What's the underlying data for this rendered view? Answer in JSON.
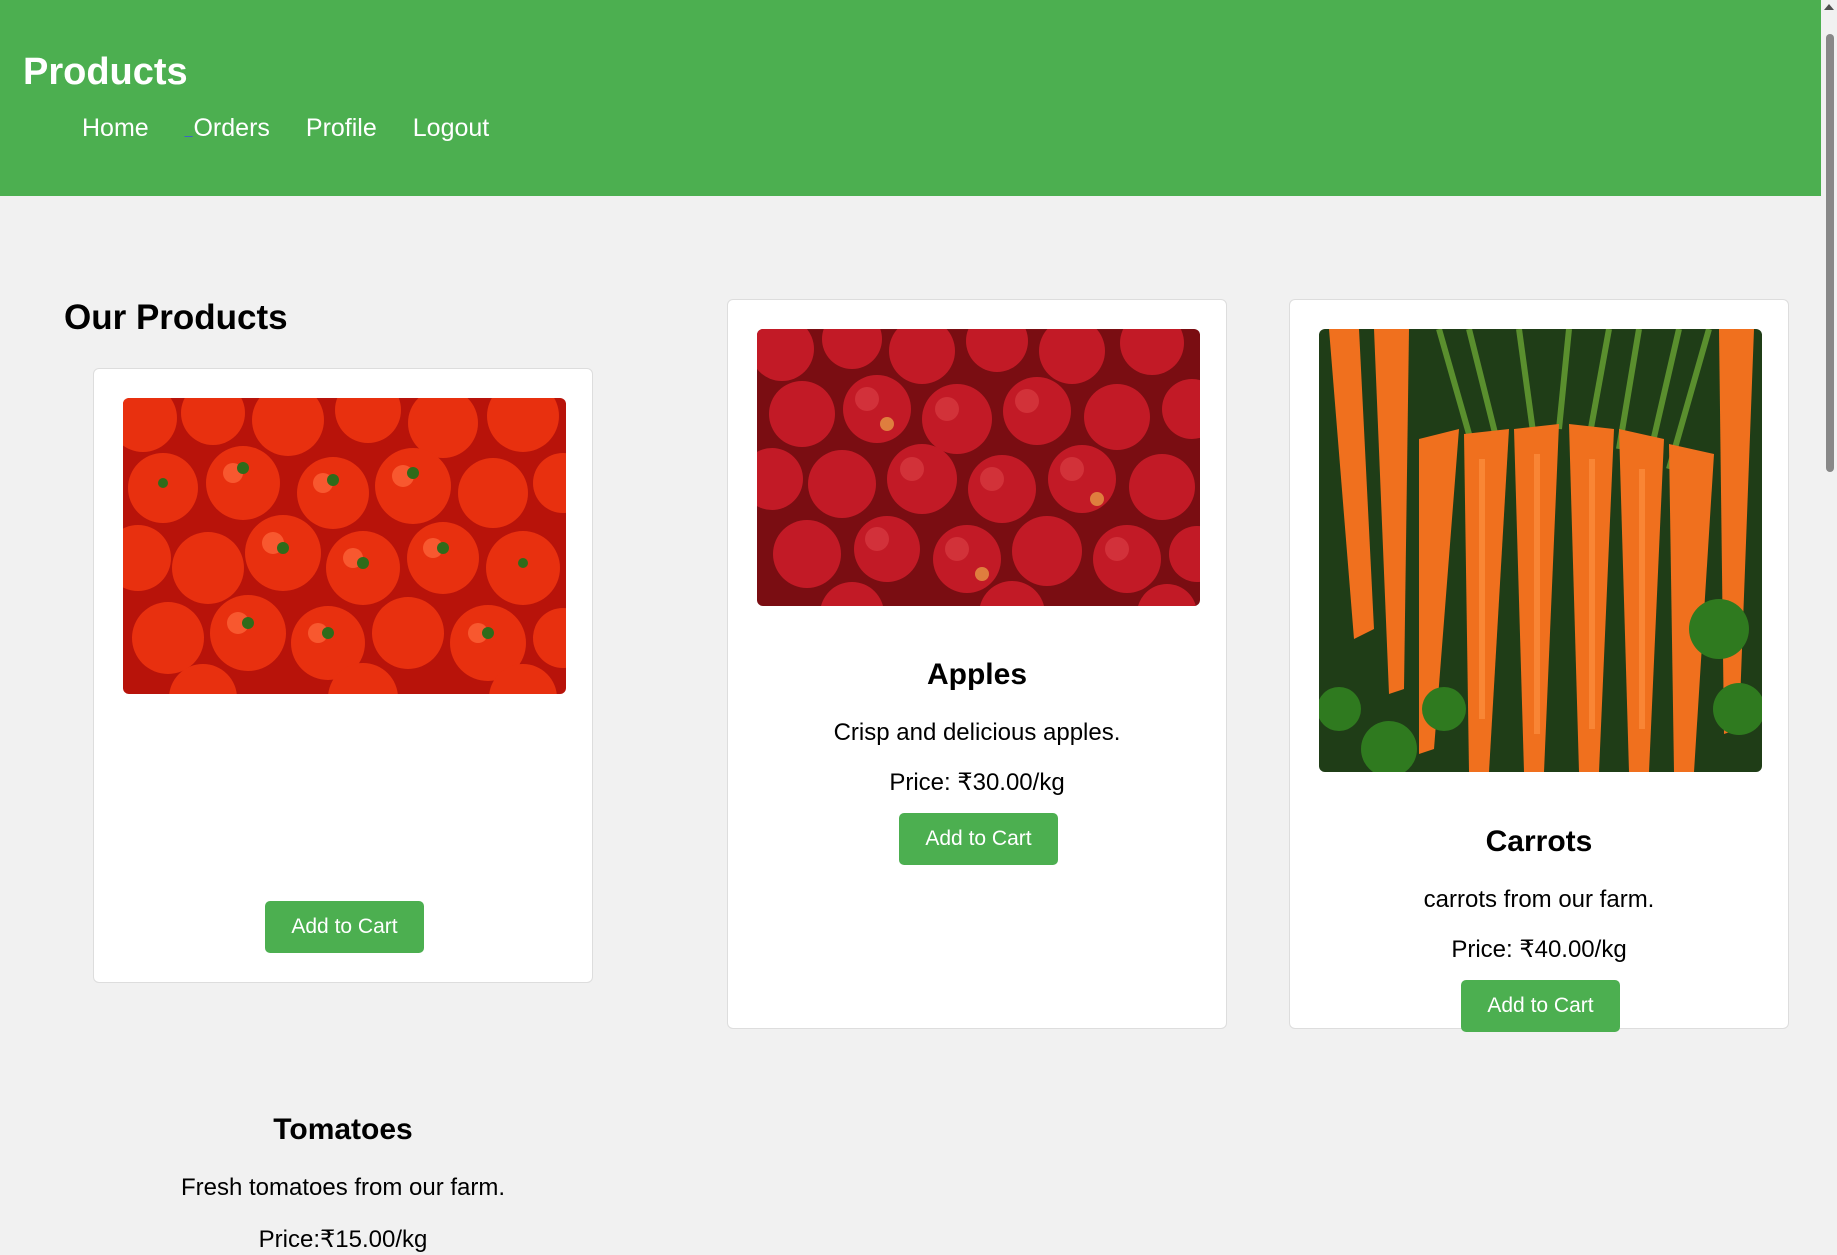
{
  "header": {
    "title": "Products",
    "bg_color": "#4caf50",
    "nav": [
      {
        "label": "Home"
      },
      {
        "label": "Orders"
      },
      {
        "label": "Profile"
      },
      {
        "label": "Logout"
      }
    ]
  },
  "main": {
    "section_title": "Our Products",
    "products": [
      {
        "name": "Tomatoes",
        "description": "Fresh tomatoes from our farm.",
        "price": "Price:₹15.00/kg",
        "button": "Add to Cart",
        "image": "tomatoes-photo"
      },
      {
        "name": "Apples",
        "description": "Crisp and delicious apples.",
        "price": "Price: ₹30.00/kg",
        "button": "Add to Cart",
        "image": "apples-photo"
      },
      {
        "name": "Carrots",
        "description": "carrots from our farm.",
        "price": "Price: ₹40.00/kg",
        "button": "Add to Cart",
        "image": "carrots-photo"
      }
    ]
  },
  "colors": {
    "accent": "#4caf50",
    "page_bg": "#f1f1f1",
    "card_bg": "#ffffff"
  }
}
